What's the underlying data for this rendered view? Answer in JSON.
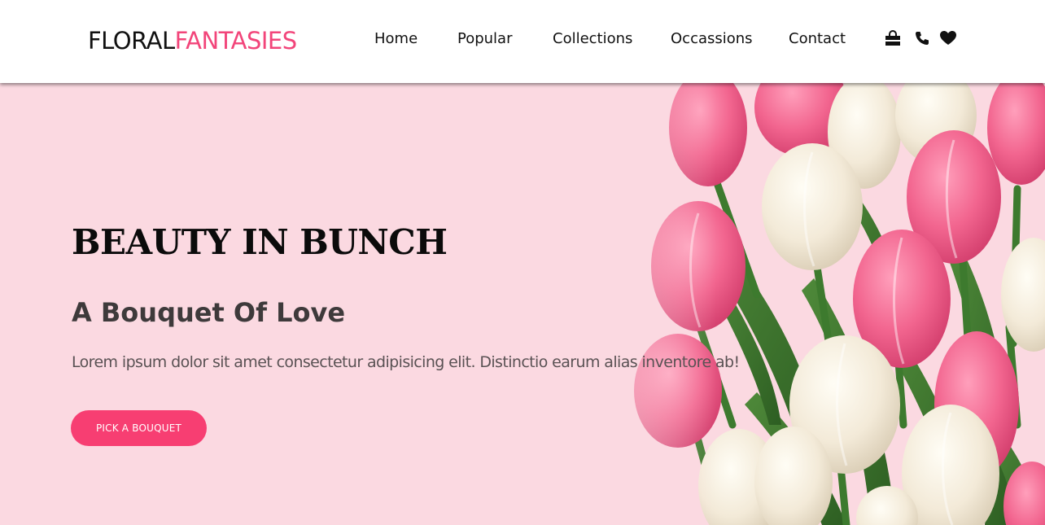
{
  "brand": {
    "name_part1": "FLORAL",
    "name_part2": "FANTASIES",
    "accent_color": "#f2457a"
  },
  "nav": {
    "items": [
      {
        "label": "Home"
      },
      {
        "label": "Popular"
      },
      {
        "label": "Collections"
      },
      {
        "label": "Occassions"
      },
      {
        "label": "Contact"
      }
    ]
  },
  "header_icons": [
    "shopping-bag-icon",
    "phone-icon",
    "heart-icon"
  ],
  "hero": {
    "title": "BEAUTY IN BUNCH",
    "subtitle": "A Bouquet Of Love",
    "text": "Lorem ipsum dolor sit amet consectetur adipisicing elit. Distinctio earum alias inventore ab!",
    "cta_label": "PICK A BOUQUET",
    "cta_color": "#f73e72",
    "background_color": "#fbd9e1"
  }
}
